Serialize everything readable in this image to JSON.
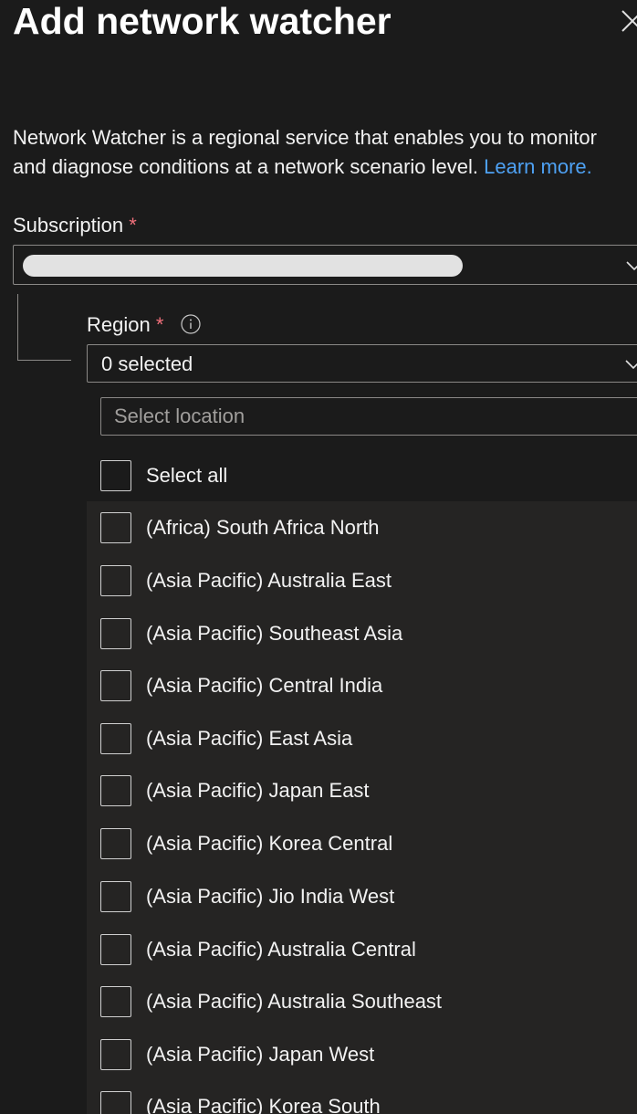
{
  "header": {
    "title": "Add network watcher",
    "close_icon": "close-icon"
  },
  "description": {
    "line1": "Network Watcher is a regional service that enables you to monitor",
    "line2": "and diagnose conditions at a network scenario level.",
    "link_text": "Learn more."
  },
  "subscription": {
    "label": "Subscription",
    "required_mark": "*",
    "value_redacted": true
  },
  "region": {
    "label": "Region",
    "required_mark": "*",
    "info_icon": "info-icon",
    "value": "0 selected",
    "search_placeholder": "Select location",
    "select_all": "Select all",
    "options": [
      "(Africa) South Africa North",
      "(Asia Pacific) Australia East",
      "(Asia Pacific) Southeast Asia",
      "(Asia Pacific) Central India",
      "(Asia Pacific) East Asia",
      "(Asia Pacific) Japan East",
      "(Asia Pacific) Korea Central",
      "(Asia Pacific) Jio India West",
      "(Asia Pacific) Australia Central",
      "(Asia Pacific) Australia Southeast",
      "(Asia Pacific) Japan West",
      "(Asia Pacific) Korea South"
    ]
  },
  "colors": {
    "background": "#1b1b1b",
    "panel": "#252423",
    "link": "#4ea1f3",
    "required": "#f1707b",
    "border": "#8a8886"
  }
}
